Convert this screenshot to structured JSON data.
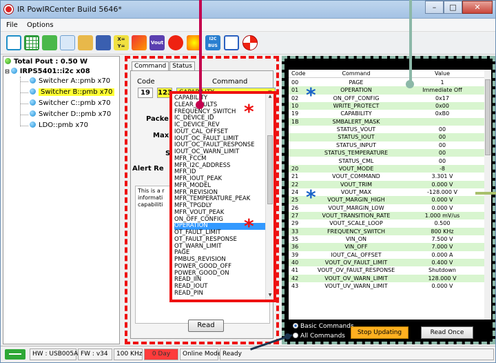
{
  "window": {
    "title": "IR PowIRCenter Build 5646*"
  },
  "menu": [
    "File",
    "Options"
  ],
  "toolbar": {
    "icons": [
      "tree-icon",
      "grid-icon",
      "export-icon",
      "chip-icon",
      "folder-icon",
      "save-icon",
      "xy-icon",
      "waveform-icon",
      "vout-icon",
      "dial-icon",
      "flame-icon",
      "i2c-bus-icon",
      "capacitor-icon",
      "lifebuoy-icon"
    ],
    "labels": {
      "xy": "X=\nY=",
      "vout": "Vout",
      "bus": "I2C\nBUS"
    }
  },
  "tree": {
    "root": "Total Pout : 0.50 W",
    "device": "IRPS5401::i2c x08",
    "items": [
      "Switcher A::pmb x70",
      "Switcher B::pmb x70",
      "Switcher C::pmb x70",
      "Switcher D::pmb x70",
      "LDO::pmb x70"
    ],
    "selected_index": 1
  },
  "command_panel": {
    "tabs": [
      "Command",
      "Status"
    ],
    "code_label": "Code",
    "command_label": "Command",
    "code_value": "19",
    "code_highlight": "123",
    "selected_command": "CAPABILITY",
    "partial_labels": [
      "Packe",
      "Maxi",
      "Alert Re"
    ],
    "description": "This is a r\ninformati\ncapabiliti",
    "read_button": "Read",
    "dropdown_items": [
      "CAPABILITY",
      "CLEAR_FAULTS",
      "FREQUENCY_SWITCH",
      "IC_DEVICE_ID",
      "IC_DEVICE_REV",
      "IOUT_CAL_OFFSET",
      "IOUT_OC_FAULT_LIMIT",
      "IOUT_OC_FAULT_RESPONSE",
      "IOUT_OC_WARN_LIMIT",
      "MFR_FCCM",
      "MFR_I2C_ADDRESS",
      "MFR_ID",
      "MFR_IOUT_PEAK",
      "MFR_MODEL",
      "MFR_REVISION",
      "MFR_TEMPERATURE_PEAK",
      "MFR_TPGDLY",
      "MFR_VOUT_PEAK",
      "ON_OFF_CONFIG",
      "OPERATION",
      "OT_FAULT_LIMIT",
      "OT_FAULT_RESPONSE",
      "OT_WARN_LIMIT",
      "PAGE",
      "PMBUS_REVISION",
      "POWER_GOOD_OFF",
      "POWER_GOOD_ON",
      "READ_IIN",
      "READ_IOUT",
      "READ_PIN"
    ],
    "dropdown_highlight_index": 19
  },
  "status_grid": {
    "headers": [
      "Code",
      "Command",
      "Value"
    ],
    "rows": [
      [
        "00",
        "PAGE",
        "1"
      ],
      [
        "01",
        "OPERATION",
        "Immediate Off"
      ],
      [
        "02",
        "ON_OFF_CONFIG",
        "0x17"
      ],
      [
        "10",
        "WRITE_PROTECT",
        "0x00"
      ],
      [
        "19",
        "CAPABILITY",
        "0xB0"
      ],
      [
        "1B",
        "SMBALERT_MASK",
        ""
      ],
      [
        "",
        "STATUS_VOUT",
        "00"
      ],
      [
        "",
        "STATUS_IOUT",
        "00"
      ],
      [
        "",
        "STATUS_INPUT",
        "00"
      ],
      [
        "",
        "STATUS_TEMPERATURE",
        "00"
      ],
      [
        "",
        "STATUS_CML",
        "00"
      ],
      [
        "20",
        "VOUT_MODE",
        "-8"
      ],
      [
        "21",
        "VOUT_COMMAND",
        "3.301 V"
      ],
      [
        "22",
        "VOUT_TRIM",
        "0.000 V"
      ],
      [
        "24",
        "VOUT_MAX",
        "-128.000 V"
      ],
      [
        "25",
        "VOUT_MARGIN_HIGH",
        "0.000 V"
      ],
      [
        "26",
        "VOUT_MARGIN_LOW",
        "0.000 V"
      ],
      [
        "27",
        "VOUT_TRANSITION_RATE",
        "1.000 mV/us"
      ],
      [
        "29",
        "VOUT_SCALE_LOOP",
        "0.500"
      ],
      [
        "33",
        "FREQUENCY_SWITCH",
        "800 KHz"
      ],
      [
        "35",
        "VIN_ON",
        "7.500 V"
      ],
      [
        "36",
        "VIN_OFF",
        "7.000 V"
      ],
      [
        "39",
        "IOUT_CAL_OFFSET",
        "0.000 A"
      ],
      [
        "40",
        "VOUT_OV_FAULT_LIMIT",
        "0.400 V"
      ],
      [
        "41",
        "VOUT_OV_FAULT_RESPONSE",
        "Shutdown"
      ],
      [
        "42",
        "VOUT_OV_WARN_LIMIT",
        "128.000 V"
      ],
      [
        "43",
        "VOUT_UV_WARN_LIMIT",
        "0.000 V"
      ]
    ],
    "radio_basic": "Basic Commands",
    "radio_all": "All Commands",
    "radio_selected": "basic",
    "stop_button": "Stop Updating",
    "readonce_button": "Read Once"
  },
  "statusbar": {
    "hw": "HW : USB005A",
    "fw": "FW : v34",
    "freq": "100 KHz",
    "day": "0 Day",
    "mode": "Online Mode",
    "state": "Ready"
  },
  "colors": {
    "highlight_yellow": "#ffff33",
    "annotation_red": "#ee1111",
    "annotation_green": "#8cb8a8",
    "stop_orange": "#ffb020",
    "row_green": "#d8f5cf"
  }
}
